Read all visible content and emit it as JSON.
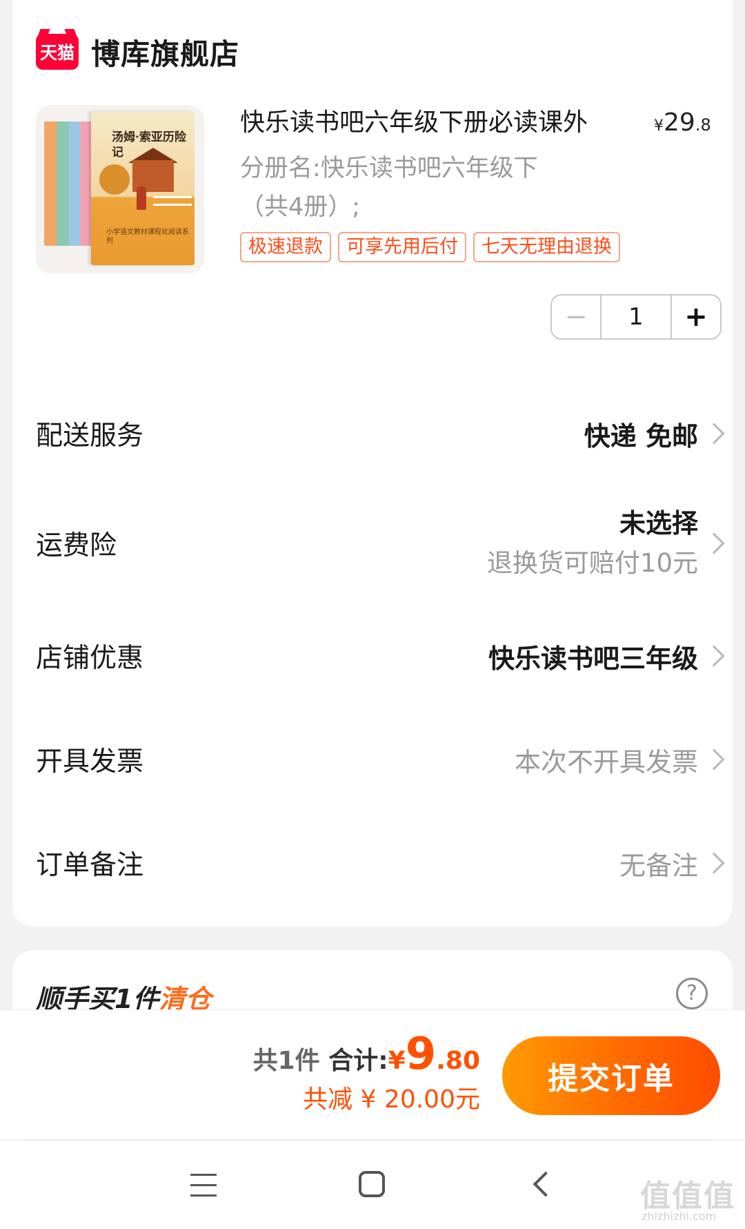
{
  "shop": {
    "logo_text": "天猫",
    "name": "博库旗舰店"
  },
  "product": {
    "cover_title": "汤姆·索亚历险记",
    "cover_subtitle": "小学语文教材课程化阅读系列",
    "title": "快乐读书吧六年级下册必读课外",
    "price_symbol": "¥",
    "price_int": "29",
    "price_dec": ".8",
    "sku_line1": "分册名:快乐读书吧六年级下",
    "sku_line2": "（共4册）;",
    "tags": [
      "极速退款",
      "可享先用后付",
      "七天无理由退换"
    ],
    "quantity": "1",
    "minus": "−",
    "plus": "+"
  },
  "rows": {
    "delivery": {
      "label": "配送服务",
      "value": "快递 免邮"
    },
    "insurance": {
      "label": "运费险",
      "value": "未选择",
      "sub": "退换货可赔付10元"
    },
    "coupon": {
      "label": "店铺优惠",
      "value": "快乐读书吧三年级"
    },
    "invoice": {
      "label": "开具发票",
      "value": "本次不开具发票"
    },
    "remark": {
      "label": "订单备注",
      "value": "无备注"
    }
  },
  "addon": {
    "title_prefix": "顺手买1件",
    "title_accent": "清仓",
    "help": "?"
  },
  "summary": {
    "count": "共1件",
    "total_label": "合计:",
    "currency": "¥",
    "total_int": "9",
    "total_dec": ".80",
    "discount": "共减 ¥ 20.00元",
    "submit": "提交订单"
  },
  "watermark": {
    "main": "值值值",
    "sub": "zhizhizhi.com"
  },
  "colors": {
    "accent": "#ff5000",
    "tmall_red": "#ff0036",
    "tag_text": "#ff4d1a",
    "submit_start": "#ff9a00",
    "submit_end": "#ff4d00"
  }
}
